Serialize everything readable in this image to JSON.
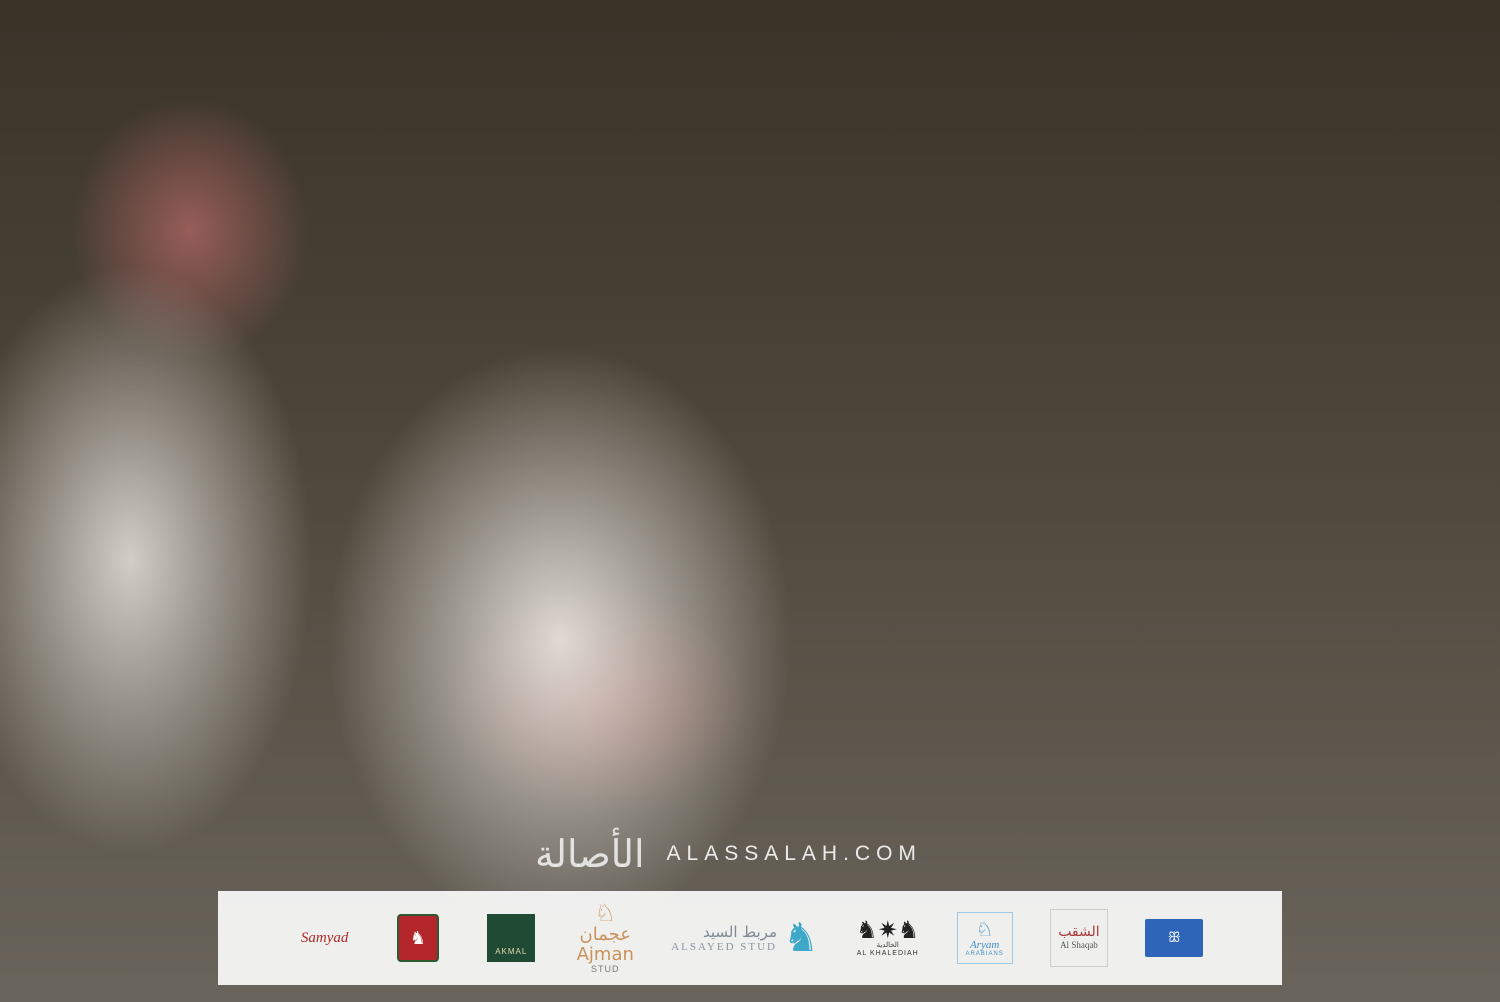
{
  "photo": {
    "description": "",
    "icon": "portrait-photo"
  },
  "watermark": {
    "arabic": "الأصالة",
    "site": "ALASSALAH.COM"
  },
  "sponsors": {
    "samyad": {
      "main": "Samyad",
      "sub": ""
    },
    "badge": {
      "glyph": "♞"
    },
    "akmal": {
      "text": "AKMAL"
    },
    "ajman": {
      "glyph": "♘",
      "arabic": "عجمان",
      "main": "Ajman",
      "sub": "STUD"
    },
    "alsayed": {
      "arabic": "مربط السيد",
      "english": "ALSAYED STUD",
      "glyph": "♞"
    },
    "khalidiah": {
      "glyph": "♞✷♞",
      "arabic": "الخالدية",
      "sub": "AL KHALEDIAH"
    },
    "aryam": {
      "glyph": "♘",
      "main": "Aryam",
      "sub": "ARABIANS"
    },
    "alshaqab": {
      "arabic": "الشقب",
      "main": "Al Shaqab"
    },
    "blue": {
      "glyph": "ꕥ"
    }
  }
}
